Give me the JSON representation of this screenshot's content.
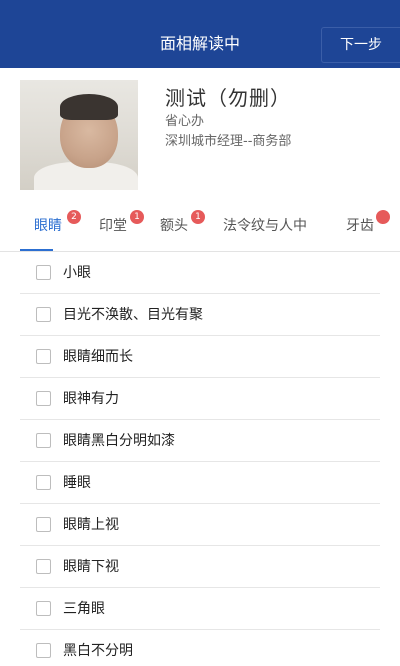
{
  "header": {
    "title": "面相解读中",
    "next_label": "下一步",
    "bar_color": "#1e4596"
  },
  "profile": {
    "name": "测试（勿删）",
    "org": "省心办",
    "dept": "深圳城市经理--商务部"
  },
  "tabs": [
    {
      "label": "眼睛",
      "badge": "2",
      "active": true
    },
    {
      "label": "印堂",
      "badge": "1"
    },
    {
      "label": "额头",
      "badge": "1"
    },
    {
      "label": "法令纹与人中"
    },
    {
      "label": "牙齿"
    }
  ],
  "options": [
    {
      "label": "小眼",
      "checked": false
    },
    {
      "label": "目光不涣散、目光有聚",
      "checked": false
    },
    {
      "label": "眼睛细而长",
      "checked": false
    },
    {
      "label": "眼神有力",
      "checked": false
    },
    {
      "label": "眼睛黑白分明如漆",
      "checked": false
    },
    {
      "label": "睡眼",
      "checked": false
    },
    {
      "label": "眼睛上视",
      "checked": false
    },
    {
      "label": "眼睛下视",
      "checked": false
    },
    {
      "label": "三角眼",
      "checked": false
    },
    {
      "label": "黑白不分明",
      "checked": false
    }
  ],
  "accent_color": "#2c6fd1",
  "badge_color": "#e65a5a"
}
